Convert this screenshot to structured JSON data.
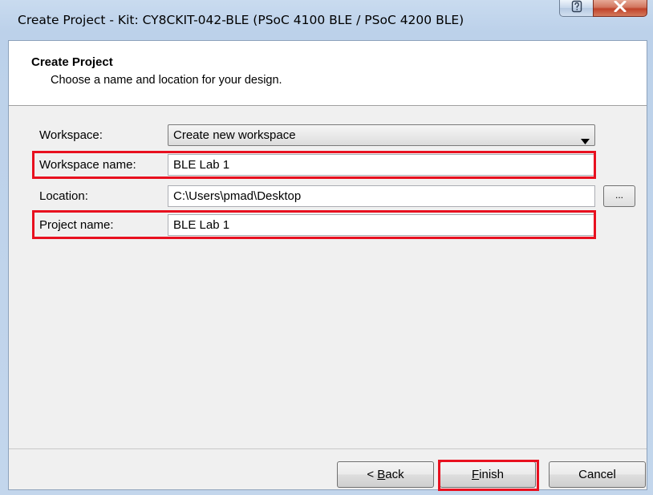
{
  "window": {
    "title": "Create Project - Kit: CY8CKIT-042-BLE (PSoC 4100 BLE / PSoC 4200 BLE)",
    "help_icon": "help-question-icon",
    "close_icon": "close-x-icon"
  },
  "header": {
    "title": "Create Project",
    "subtitle": "Choose a name and location for your design."
  },
  "form": {
    "workspace_label": "Workspace:",
    "workspace_value": "Create new workspace",
    "workspace_name_label": "Workspace name:",
    "workspace_name_value": "BLE Lab 1",
    "location_label": "Location:",
    "location_value": "C:\\Users\\pmad\\Desktop",
    "browse_label": "...",
    "project_name_label": "Project name:",
    "project_name_value": "BLE Lab 1"
  },
  "buttons": {
    "back_prefix": "< ",
    "back_mnemonic": "B",
    "back_rest": "ack",
    "finish_mnemonic": "F",
    "finish_rest": "inish",
    "cancel": "Cancel"
  },
  "colors": {
    "highlight": "#e8101f",
    "title_bar": "#c9dbef"
  }
}
